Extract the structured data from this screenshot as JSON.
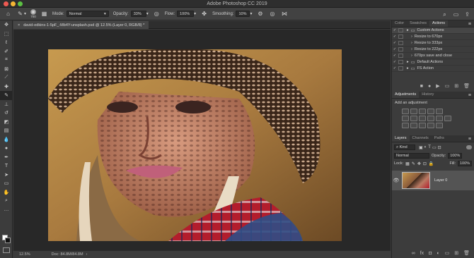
{
  "window": {
    "title": "Adobe Photoshop CC 2019"
  },
  "options_bar": {
    "brush_size": "700",
    "mode_label": "Mode:",
    "mode_value": "Normal",
    "opacity_label": "Opacity:",
    "opacity_value": "33%",
    "flow_label": "Flow:",
    "flow_value": "100%",
    "smoothing_label": "Smoothing:",
    "smoothing_value": "10%"
  },
  "document_tab": {
    "label": "david-edkins-1-5pF_-Mb4Y-unsplash.psd @ 12.5% (Layer 0, RGB/8) *"
  },
  "status_bar": {
    "zoom": "12.5%",
    "doc_info": "Doc: 84.8M/84.8M"
  },
  "panels": {
    "top_tabs": [
      "Color",
      "Swatches",
      "Actions"
    ],
    "actions": [
      {
        "label": "Custom Actions",
        "indent": 1
      },
      {
        "label": "Resize to 670px",
        "indent": 2
      },
      {
        "label": "Resize to 333px",
        "indent": 2
      },
      {
        "label": "Resize to 222px",
        "indent": 2
      },
      {
        "label": "670px save and close",
        "indent": 2
      },
      {
        "label": "Default Actions",
        "indent": 1
      },
      {
        "label": "FS Action",
        "indent": 1
      }
    ],
    "adjustments_tabs": [
      "Adjustments",
      "History"
    ],
    "adjustments_hint": "Add an adjustment",
    "layers_tabs": [
      "Layers",
      "Channels",
      "Paths"
    ],
    "layers_kind": "Kind",
    "blend_mode": "Normal",
    "opacity_label": "Opacity:",
    "opacity_value": "100%",
    "lock_label": "Lock:",
    "fill_label": "Fill:",
    "fill_value": "100%",
    "layer_name": "Layer 0"
  },
  "colors": {
    "foreground": "#ffffff",
    "background": "#111111",
    "accent": "#2d8ceb"
  },
  "icons": [
    "move-icon",
    "marquee-icon",
    "lasso-icon",
    "quick-select-icon",
    "crop-icon",
    "frame-icon",
    "eyedropper-icon",
    "healing-icon",
    "brush-icon",
    "stamp-icon",
    "history-brush-icon",
    "eraser-icon",
    "gradient-icon",
    "blur-icon",
    "dodge-icon",
    "pen-icon",
    "type-icon",
    "path-select-icon",
    "shape-icon",
    "hand-icon",
    "zoom-icon",
    "search-icon",
    "workspace-icon",
    "share-icon",
    "eye-icon"
  ]
}
